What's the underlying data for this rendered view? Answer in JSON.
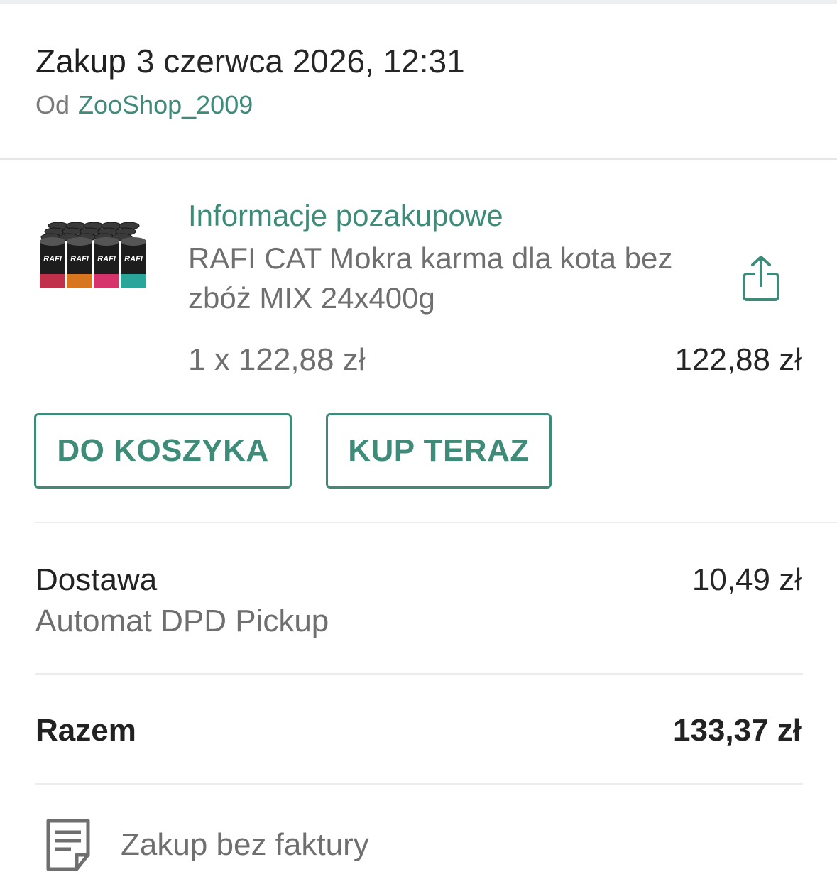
{
  "header": {
    "title_word": "Zakup",
    "date": "3 czerwca 2026, 12:31",
    "seller_prefix": "Od",
    "seller_name": "ZooShop_2009"
  },
  "item": {
    "info_link": "Informacje pozakupowe",
    "name": "RAFI CAT Mokra karma dla kota bez zbóż MIX 24x400g",
    "quantity_line": "1 x 122,88 zł",
    "line_total": "122,88 zł",
    "image_brand_text": "RAFI",
    "share_icon": "share-icon"
  },
  "actions": {
    "add_to_cart": "DO KOSZYKA",
    "buy_now": "KUP TERAZ"
  },
  "delivery": {
    "label": "Dostawa",
    "method": "Automat DPD Pickup",
    "price": "10,49 zł"
  },
  "total": {
    "label": "Razem",
    "price": "133,37 zł"
  },
  "invoice": {
    "icon": "document-icon",
    "text": "Zakup bez faktury"
  },
  "colors": {
    "accent": "#3d8b78",
    "muted_text": "#6f6f6f",
    "divider": "#ececec"
  }
}
